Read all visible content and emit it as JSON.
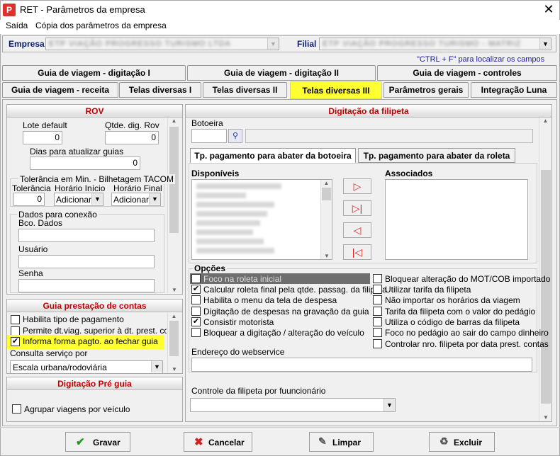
{
  "window": {
    "title": "RET - Parâmetros da empresa",
    "close": "✕"
  },
  "menu": {
    "saida": "Saída",
    "copia": "Cópia dos parâmetros da empresa"
  },
  "empresa": {
    "label": "Empresa",
    "filial_label": "Filial",
    "hint": "\"CTRL + F\" para localizar os campos"
  },
  "tabs_row1": [
    "Guia de viagem - digitação I",
    "Guia de viagem - digitação II",
    "Guia de viagem - controles"
  ],
  "tabs_row2": [
    "Guia de viagem - receita",
    "Telas diversas I",
    "Telas diversas II",
    "Telas diversas III",
    "Parâmetros gerais",
    "Integração Luna"
  ],
  "rov": {
    "header": "ROV",
    "lote_label": "Lote default",
    "lote_value": "0",
    "qtde_label": "Qtde. dig. Rov",
    "qtde_value": "0",
    "dias_label": "Dias para atualizar guias",
    "dias_value": "0",
    "tolerancia_group": "Tolerância em Min. - Bilhetagem TACOM",
    "tolerancia_label": "Tolerância",
    "tolerancia_value": "0",
    "horario_inicio_label": "Horário Início",
    "horario_inicio_value": "Adicionar",
    "horario_final_label": "Horário Final",
    "horario_final_value": "Adicionar",
    "conexao_group": "Dados para conexão",
    "bco_label": "Bco. Dados",
    "usuario_label": "Usuário",
    "senha_label": "Senha"
  },
  "prestacao": {
    "header": "Guia prestação de contas",
    "items": [
      {
        "label": "Habilita tipo de pagamento",
        "checked": false
      },
      {
        "label": "Permite dt.viag. superior à dt. prest. contas",
        "checked": false
      },
      {
        "label": "Informa forma pagto. ao fechar guia",
        "checked": true
      }
    ],
    "consulta_label": "Consulta serviço por",
    "consulta_value": "Escala urbana/rodoviária"
  },
  "pre_guia": {
    "header": "Digitação Pré guia",
    "agrupar_label": "Agrupar viagens por veículo"
  },
  "filipeta": {
    "header": "Digitação da filipeta",
    "botoeira_label": "Botoeira",
    "subtab1": "Tp. pagamento para abater da botoeira",
    "subtab2": "Tp. pagamento para abater da roleta",
    "disponiveis_label": "Disponíveis",
    "associados_label": "Associados",
    "opcoes_label": "Opções",
    "opcoes_left": [
      {
        "label": "Foco na roleta inicial",
        "checked": false
      },
      {
        "label": "Calcular roleta final pela qtde. passag. da filipeta",
        "checked": true
      },
      {
        "label": "Habilita o menu da tela de despesa",
        "checked": false
      },
      {
        "label": "Digitação de despesas na gravação da guia",
        "checked": false
      },
      {
        "label": "Consistir motorista",
        "checked": true
      },
      {
        "label": "Bloquear a digitação / alteração do veículo",
        "checked": false
      }
    ],
    "opcoes_right": [
      {
        "label": "Bloquear alteração do MOT/COB importado",
        "checked": false
      },
      {
        "label": "Utilizar tarifa da filipeta",
        "checked": false
      },
      {
        "label": "Não importar os horários da viagem",
        "checked": false
      },
      {
        "label": "Tarifa da filipeta com o valor do pedágio",
        "checked": false
      },
      {
        "label": "Utiliza o código de barras da filipeta",
        "checked": false
      },
      {
        "label": "Foco no pedágio ao sair do campo dinheiro",
        "checked": false
      },
      {
        "label": "Controlar nro. filipeta por data prest. contas",
        "checked": false
      }
    ],
    "endereco_label": "Endereço do webservice",
    "controle_label": "Controle da filipeta por fuuncionário"
  },
  "footer": {
    "gravar": "Gravar",
    "cancelar": "Cancelar",
    "limpar": "Limpar",
    "excluir": "Excluir"
  }
}
